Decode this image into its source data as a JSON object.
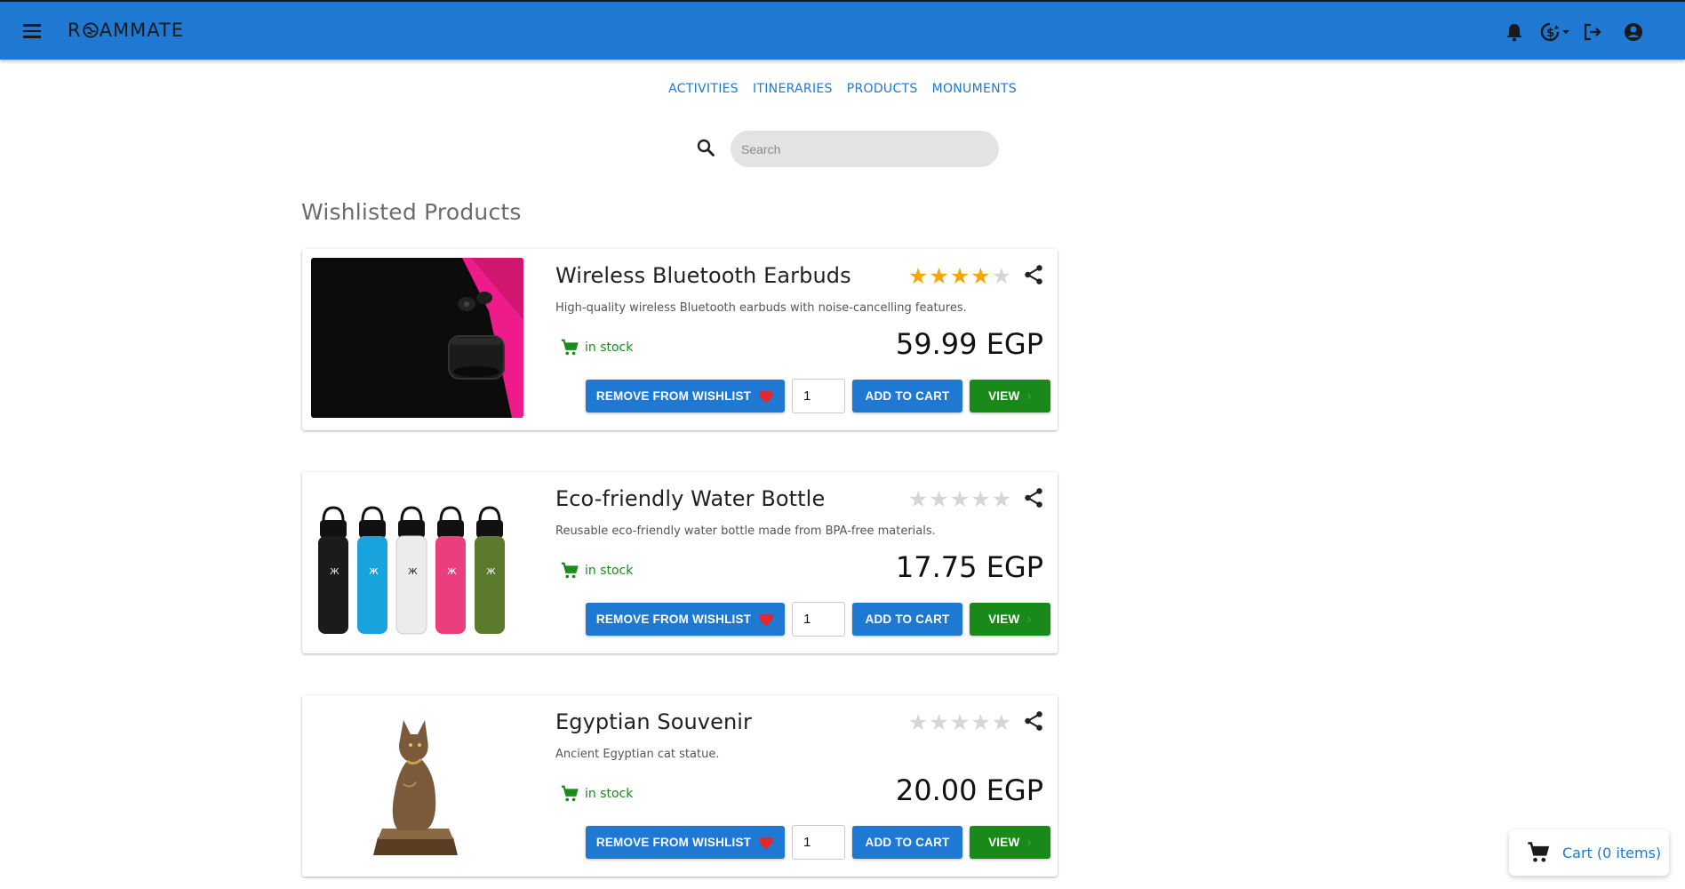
{
  "app": {
    "brand": "ROAMMATE",
    "brand_prefix": "R",
    "brand_suffix": "AMMATE",
    "accent_color": "#1f78d1",
    "success_color": "#198a19"
  },
  "appbar_icons": [
    "menu-icon",
    "bell-icon",
    "currency-exchange-icon",
    "logout-icon",
    "account-circle-icon"
  ],
  "nav": {
    "links": [
      "ACTIVITIES",
      "ITINERARIES",
      "PRODUCTS",
      "MONUMENTS"
    ]
  },
  "search": {
    "placeholder": "Search",
    "value": ""
  },
  "section_title": "Wishlisted Products",
  "products": [
    {
      "name": "Wireless Bluetooth Earbuds",
      "description": "High-quality wireless Bluetooth earbuds with noise-cancelling features.",
      "stock": "in stock",
      "price": "59.99 EGP",
      "rating": 4,
      "rating_max": 5,
      "quantity": "1",
      "remove_label": "REMOVE FROM WISHLIST",
      "add_label": "ADD TO CART",
      "view_label": "VIEW"
    },
    {
      "name": "Eco-friendly Water Bottle",
      "description": "Reusable eco-friendly water bottle made from BPA-free materials.",
      "stock": "in stock",
      "price": "17.75 EGP",
      "rating": 0,
      "rating_max": 5,
      "quantity": "1",
      "remove_label": "REMOVE FROM WISHLIST",
      "add_label": "ADD TO CART",
      "view_label": "VIEW"
    },
    {
      "name": "Egyptian Souvenir",
      "description": "Ancient Egyptian cat statue.",
      "stock": "in stock",
      "price": "20.00 EGP",
      "rating": 0,
      "rating_max": 5,
      "quantity": "1",
      "remove_label": "REMOVE FROM WISHLIST",
      "add_label": "ADD TO CART",
      "view_label": "VIEW"
    }
  ],
  "cart": {
    "label": "Cart (0 items)"
  }
}
